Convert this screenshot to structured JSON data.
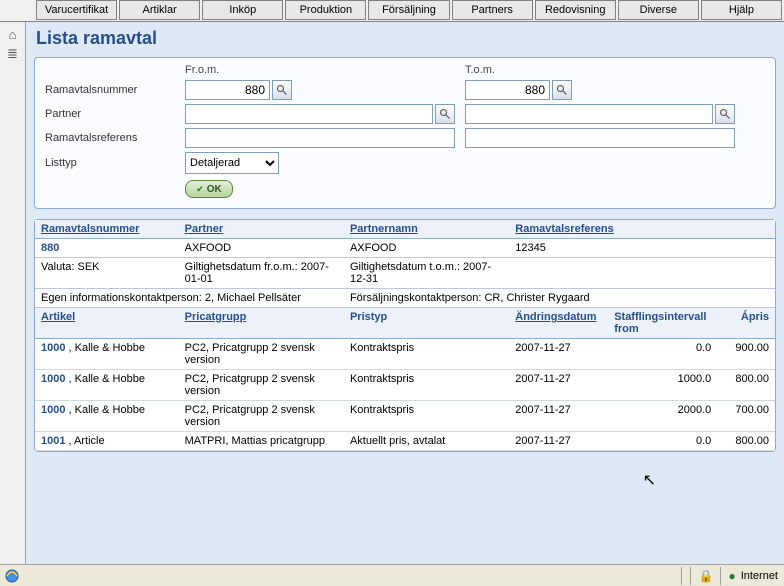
{
  "menu": {
    "varucertifikat": "Varucertifikat",
    "artiklar": "Artiklar",
    "inkop": "Inköp",
    "produktion": "Produktion",
    "forsaljning": "Försäljning",
    "partners": "Partners",
    "redovisning": "Redovisning",
    "diverse": "Diverse",
    "hjalp": "Hjälp"
  },
  "page": {
    "title": "Lista ramavtal"
  },
  "filter": {
    "labels": {
      "from": "Fr.o.m.",
      "to": "T.o.m.",
      "ramavtalsnummer": "Ramavtalsnummer",
      "partner": "Partner",
      "ramavtalsreferens": "Ramavtalsreferens",
      "listtyp": "Listtyp"
    },
    "values": {
      "nummer_from": "880",
      "nummer_to": "880",
      "partner_from": "",
      "partner_to": "",
      "referens_from": "",
      "referens_to": "",
      "listtyp_selected": "Detaljerad"
    },
    "ok_label": "OK"
  },
  "results": {
    "head": {
      "ramavtalsnummer": "Ramavtalsnummer",
      "partner": "Partner",
      "partnernamn": "Partnernamn",
      "ramavtalsreferens": "Ramavtalsreferens"
    },
    "row1": {
      "ramavtalsnummer": "880",
      "partner": "AXFOOD",
      "partnernamn": "AXFOOD",
      "ramavtalsreferens": "12345"
    },
    "row2": {
      "valuta": "Valuta: SEK",
      "giltig_from": "Giltighetsdatum fr.o.m.: 2007-01-01",
      "giltig_to": "Giltighetsdatum t.o.m.: 2007-12-31"
    },
    "row3": {
      "infokontakt": "Egen informationskontaktperson: 2, Michael Pellsäter",
      "forsaljkontakt": "Försäljningskontaktperson: CR, Christer Rygaard"
    },
    "grid_head": {
      "artikel": "Artikel",
      "pricatgrupp": "Pricatgrupp",
      "pristyp": "Pristyp",
      "andringsdatum": "Ändringsdatum",
      "stafflingsintervall": "Stafflingsintervall from",
      "apris": "Ápris"
    },
    "rows": [
      {
        "artikel_id": "1000",
        "artikel_name": ", Kalle & Hobbe",
        "pricatgrupp": "PC2, Pricatgrupp 2 svensk version",
        "pristyp": "Kontraktspris",
        "andringsdatum": "2007-11-27",
        "staffling": "0.0",
        "apris": "900.00"
      },
      {
        "artikel_id": "1000",
        "artikel_name": ", Kalle & Hobbe",
        "pricatgrupp": "PC2, Pricatgrupp 2 svensk version",
        "pristyp": "Kontraktspris",
        "andringsdatum": "2007-11-27",
        "staffling": "1000.0",
        "apris": "800.00"
      },
      {
        "artikel_id": "1000",
        "artikel_name": ", Kalle & Hobbe",
        "pricatgrupp": "PC2, Pricatgrupp 2 svensk version",
        "pristyp": "Kontraktspris",
        "andringsdatum": "2007-11-27",
        "staffling": "2000.0",
        "apris": "700.00"
      },
      {
        "artikel_id": "1001",
        "artikel_name": ", Article",
        "pricatgrupp": "MATPRI, Mattias pricatgrupp",
        "pristyp": "Aktuellt pris, avtalat",
        "andringsdatum": "2007-11-27",
        "staffling": "0.0",
        "apris": "800.00"
      }
    ]
  },
  "status": {
    "zone": "Internet"
  }
}
